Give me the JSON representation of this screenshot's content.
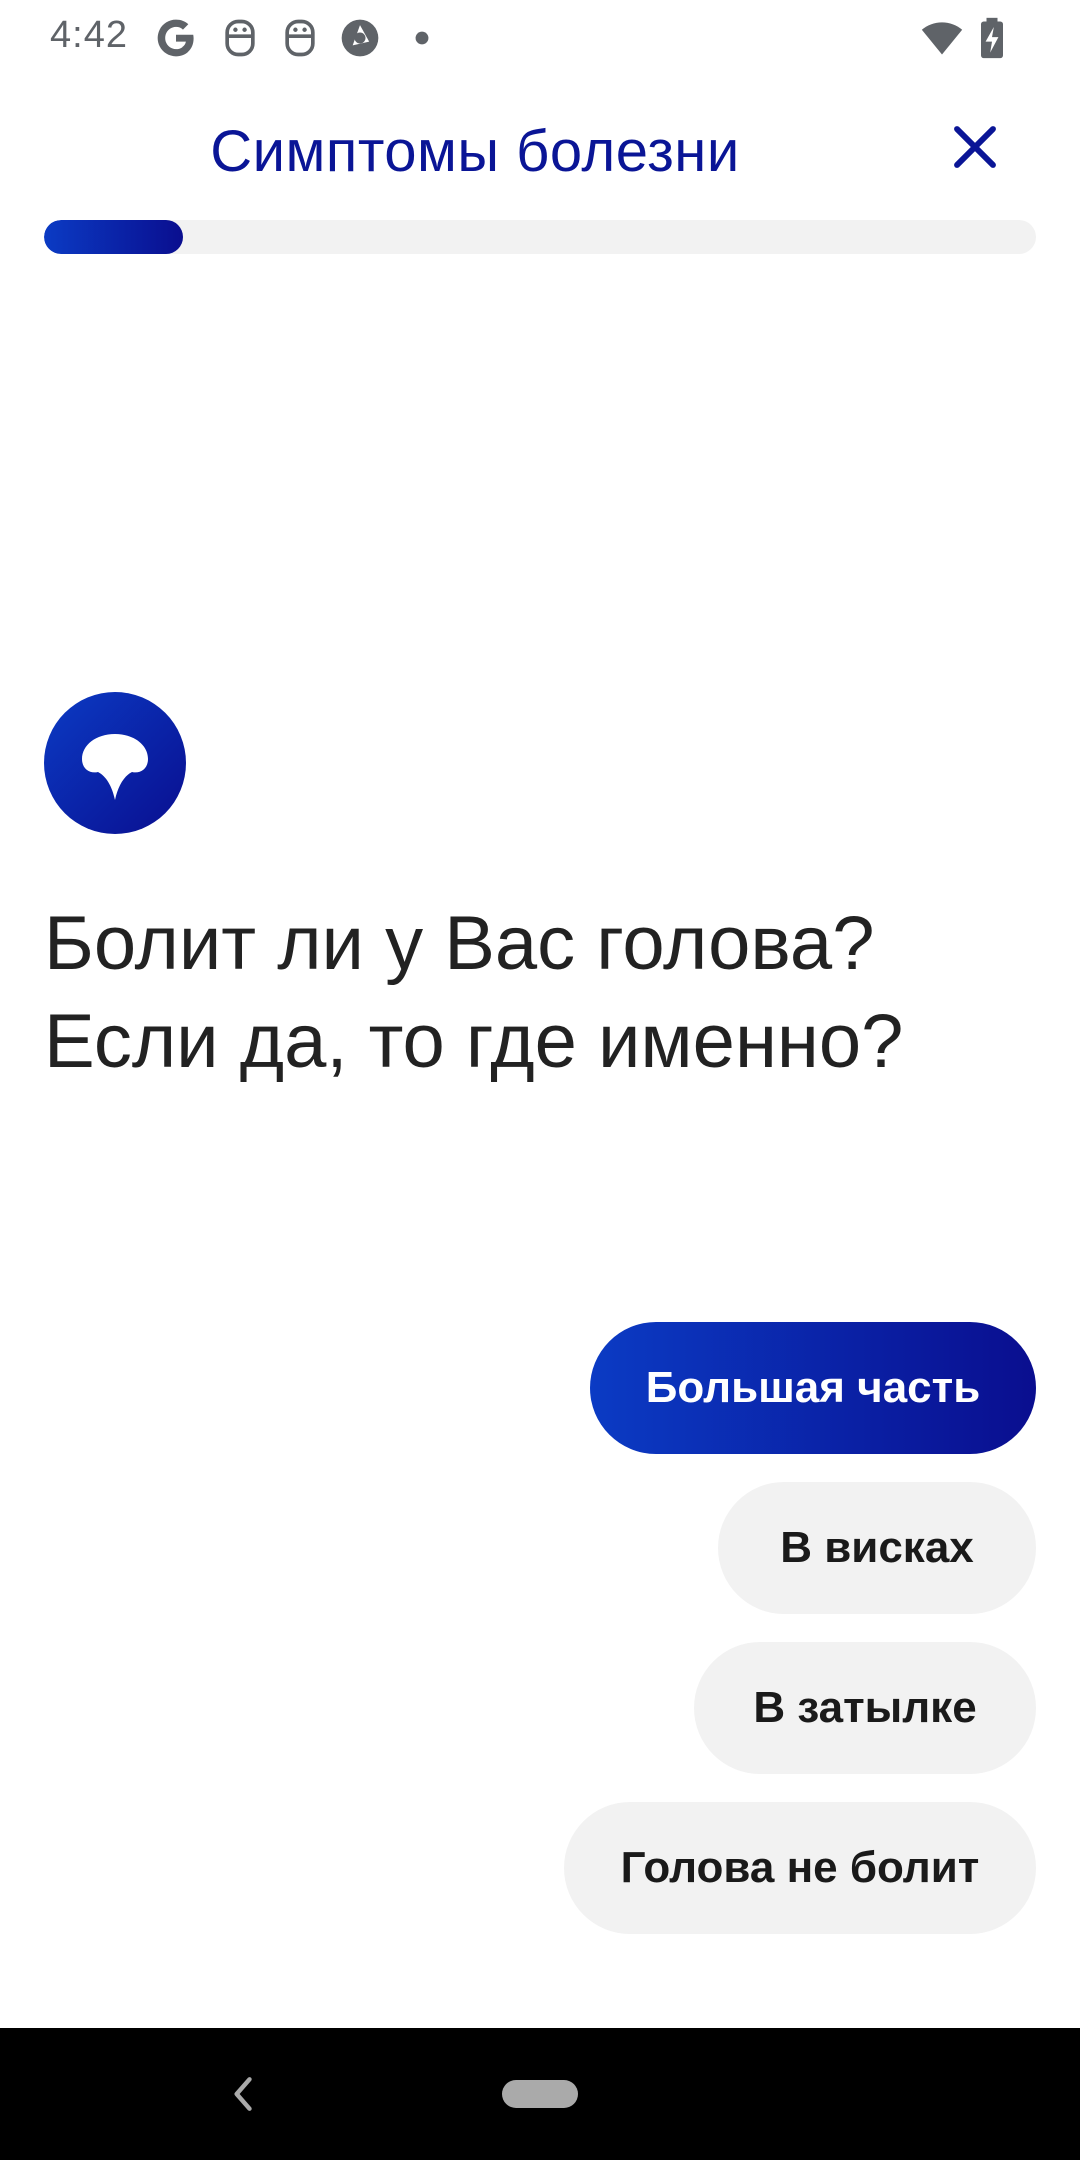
{
  "status_bar": {
    "time": "4:42",
    "icons": [
      "google-icon",
      "robot-icon",
      "robot-icon",
      "aperture-icon",
      "dot-icon",
      "wifi-icon",
      "battery-charging-icon"
    ]
  },
  "header": {
    "title": "Симптомы болезни",
    "close_icon": "close-icon"
  },
  "progress": {
    "value": 0.14
  },
  "chat": {
    "bot_avatar_icon": "bot-logo-icon",
    "question_lines": [
      "Болит ли у Вас голова?",
      "Если да, то где именно?"
    ]
  },
  "answers": [
    {
      "label": "Большая часть",
      "selected": true
    },
    {
      "label": "В висках",
      "selected": false
    },
    {
      "label": "В затылке",
      "selected": false
    },
    {
      "label": "Голова не болит",
      "selected": false
    }
  ],
  "nav_bar": {
    "back_icon": "back-icon",
    "home_icon": "home-pill-icon"
  },
  "colors": {
    "accent": "#0a1596",
    "gradient_start": "#0b3bc4",
    "gradient_end": "#0a0e8f",
    "chip_bg": "#f2f2f2"
  }
}
